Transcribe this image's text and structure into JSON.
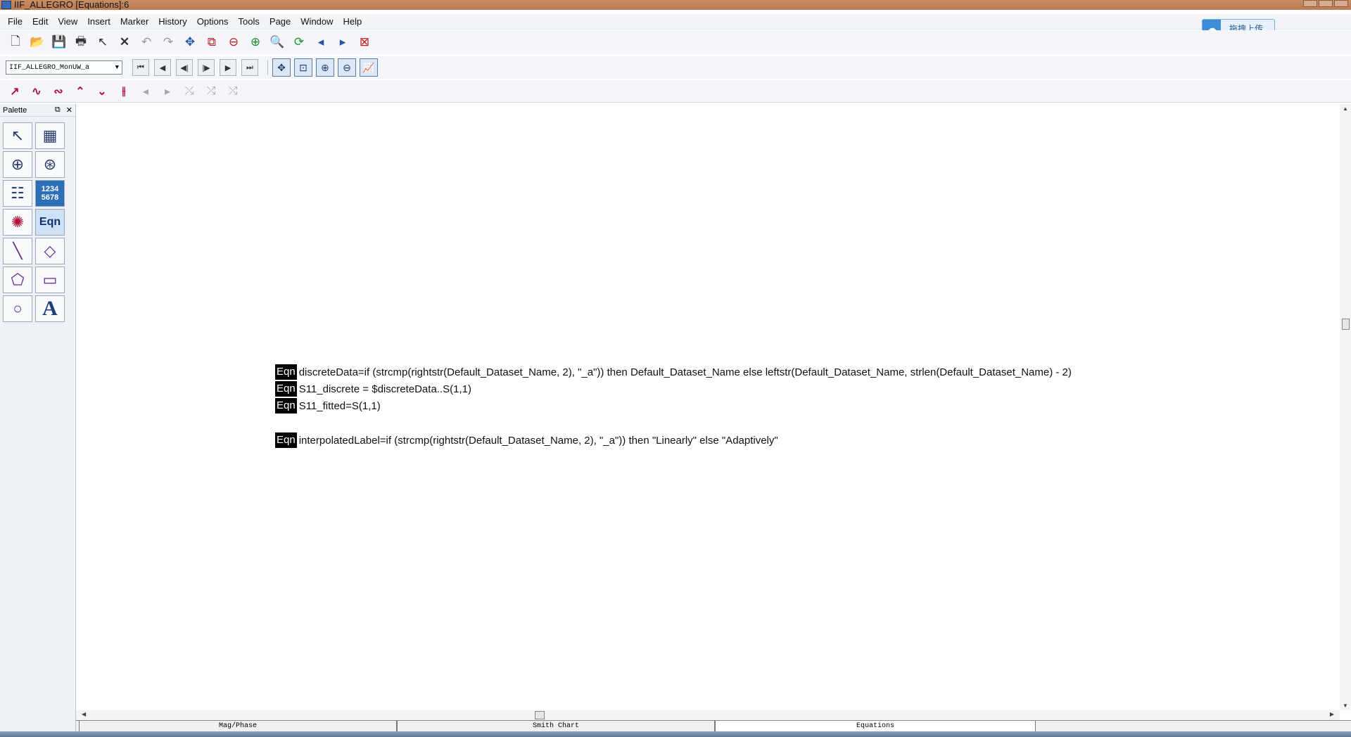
{
  "window": {
    "title": "IIF_ALLEGRO [Equations]:6"
  },
  "menu": [
    "File",
    "Edit",
    "View",
    "Insert",
    "Marker",
    "History",
    "Options",
    "Tools",
    "Page",
    "Window",
    "Help"
  ],
  "upload_button": {
    "label": "拖拽上传"
  },
  "toolbar2": {
    "dataset_selected": "IIF_ALLEGRO_MonUW_a"
  },
  "palette": {
    "title": "Palette",
    "eqn_label": "Eqn",
    "numeric_label": "1234\n5678",
    "text_label": "A"
  },
  "equations": [
    {
      "tag": "Eqn",
      "text": "discreteData=if (strcmp(rightstr(Default_Dataset_Name, 2), \"_a\")) then Default_Dataset_Name else leftstr(Default_Dataset_Name, strlen(Default_Dataset_Name) - 2)"
    },
    {
      "tag": "Eqn",
      "text": "S11_discrete = $discreteData..S(1,1)"
    },
    {
      "tag": "Eqn",
      "text": "S11_fitted=S(1,1)"
    },
    {
      "tag": "Eqn",
      "text": "interpolatedLabel=if (strcmp(rightstr(Default_Dataset_Name, 2), \"_a\")) then \"Linearly\" else \"Adaptively\""
    }
  ],
  "page_tabs": [
    {
      "label": "Mag/Phase",
      "active": false
    },
    {
      "label": "Smith Chart",
      "active": false
    },
    {
      "label": "Equations",
      "active": true
    }
  ]
}
